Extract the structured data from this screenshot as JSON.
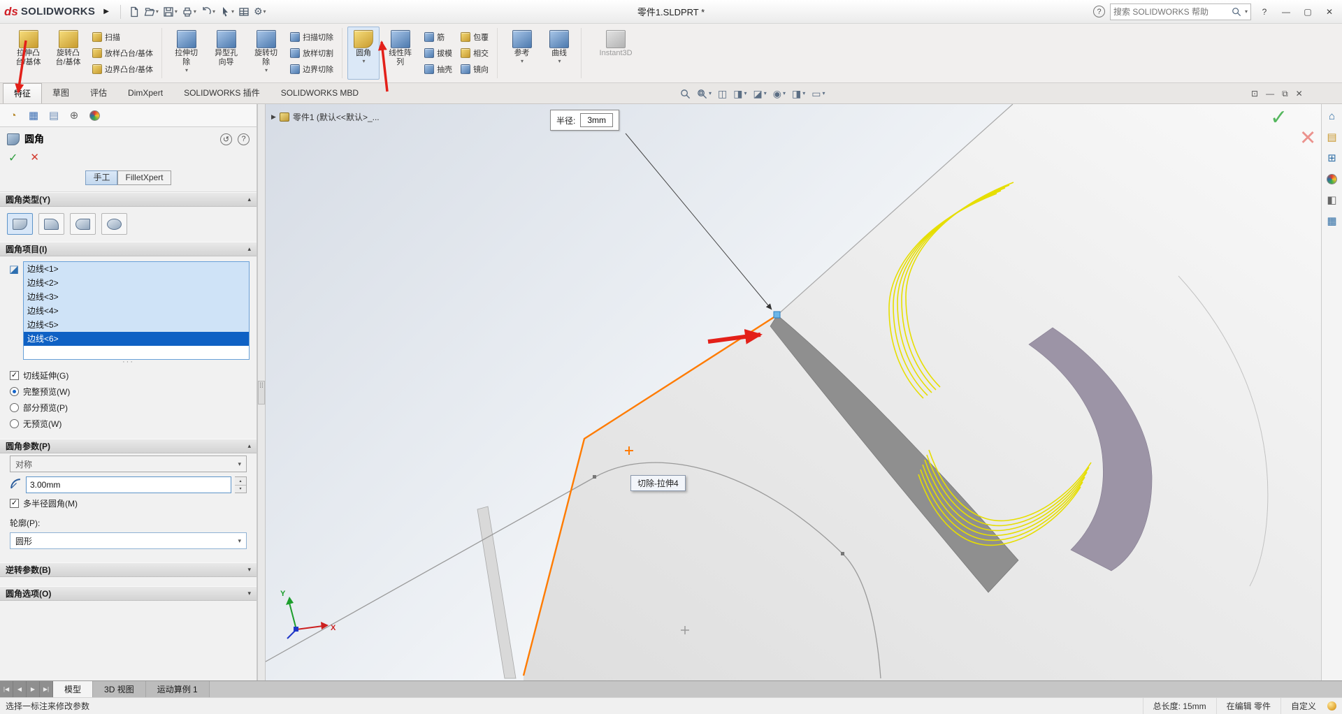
{
  "icons": {
    "check": "✓",
    "cross": "✕",
    "chev_down": "▾",
    "chev_up": "▴",
    "play": "▶",
    "question": "?",
    "undo": "↺",
    "gear": "⚙",
    "dots": "···",
    "grip": "⁞⁞"
  },
  "glyphs": {
    "tree1": "◔",
    "tree2": "▦",
    "tree3": "▤",
    "tree4": "⊕",
    "hud3": "◫",
    "hud4": "◨",
    "hud5": "◪",
    "hud6": "◉",
    "hud7": "▭",
    "win1": "⊡",
    "win2": "—",
    "win3": "⧉",
    "win4": "✕",
    "tp_home": "⌂",
    "tp_lib": "▤",
    "tp_explorer": "⊞",
    "tp_scene": "◧",
    "tp_props": "▦",
    "nav_first": "|◀",
    "nav_prev": "◀",
    "nav_next": "▶",
    "nav_last": "▶|",
    "edge_sel": "◪"
  },
  "titlebar": {
    "brand_ds": "ds",
    "brand": "SOLIDWORKS",
    "doc_title": "零件1.SLDPRT *",
    "search_placeholder": "搜索 SOLIDWORKS 帮助",
    "minimize": "—",
    "maximize": "▢",
    "close": "✕"
  },
  "ribbon": {
    "g1b1a": "拉伸凸",
    "g1b1b": "台/基体",
    "g1b2a": "旋转凸",
    "g1b2b": "台/基体",
    "g1s1": "扫描",
    "g1s2": "放样凸台/基体",
    "g1s3": "边界凸台/基体",
    "g2b1a": "拉伸切",
    "g2b1b": "除",
    "g2b2a": "异型孔",
    "g2b2b": "向导",
    "g2b3a": "旋转切",
    "g2b3b": "除",
    "g2s1": "扫描切除",
    "g2s2": "放样切割",
    "g2s3": "边界切除",
    "g3b1": "圆角",
    "g3b2a": "线性阵",
    "g3b2b": "列",
    "g3s1": "筋",
    "g3s2": "拔模",
    "g3s3": "抽壳",
    "g3s4": "包覆",
    "g3s5": "相交",
    "g3s6": "镜向",
    "g4b1": "参考",
    "g4b2": "曲线",
    "g5b1": "Instant3D"
  },
  "cmdtabs": {
    "t1": "特征",
    "t2": "草图",
    "t3": "评估",
    "t4": "DimXpert",
    "t5": "SOLIDWORKS 插件",
    "t6": "SOLIDWORKS MBD"
  },
  "pm": {
    "title": "圆角",
    "mode_manual": "手工",
    "mode_expert": "FilletXpert",
    "sec_type": "圆角类型(Y)",
    "sec_items": "圆角项目(I)",
    "sec_params": "圆角参数(P)",
    "sec_setback": "逆转参数(B)",
    "sec_options": "圆角选项(O)",
    "edges": [
      "边线<1>",
      "边线<2>",
      "边线<3>",
      "边线<4>",
      "边线<5>",
      "边线<6>"
    ],
    "tangent": "切线延伸(G)",
    "preview_full": "完整预览(W)",
    "preview_partial": "部分预览(P)",
    "preview_none": "无预览(W)",
    "symmetry": "对称",
    "radius": "3.00mm",
    "multi_radius": "多半径圆角(M)",
    "profile_label": "轮廓(P):",
    "profile": "圆形"
  },
  "viewport": {
    "breadcrumb": "零件1 (默认<<默认>_...",
    "dim_label": "半径:",
    "dim_value": "3mm",
    "tooltip": "切除-拉伸4",
    "axis_x": "X",
    "axis_y": "Y"
  },
  "bottom": {
    "t1": "模型",
    "t2": "3D 视图",
    "t3": "运动算例 1"
  },
  "status": {
    "hint": "选择一标注来修改参数",
    "length": "总长度: 15mm",
    "editing": "在编辑 零件",
    "custom": "自定义"
  },
  "colors": {
    "selection": "#1464c8",
    "edge_highlight": "#ff7b00",
    "preview_yellow": "#e6de00",
    "annotation_red": "#e32019"
  }
}
